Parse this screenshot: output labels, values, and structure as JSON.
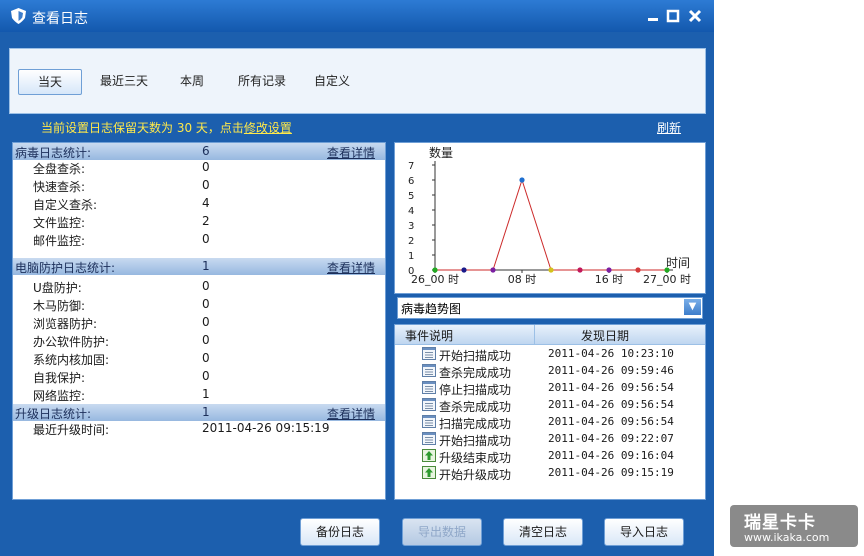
{
  "window": {
    "title": "查看日志"
  },
  "tabs": [
    {
      "label": "当天",
      "active": true
    },
    {
      "label": "最近三天",
      "active": false
    },
    {
      "label": "本周",
      "active": false
    },
    {
      "label": "所有记录",
      "active": false
    },
    {
      "label": "自定义",
      "active": false
    }
  ],
  "info": {
    "text": "当前设置日志保留天数为 30 天，点击",
    "link": "修改设置",
    "refresh": "刷新"
  },
  "stats": {
    "virus": {
      "label": "病毒日志统计:",
      "count": "6",
      "detail": "查看详情",
      "items": [
        {
          "label": "全盘查杀:",
          "count": "0"
        },
        {
          "label": "快速查杀:",
          "count": "0"
        },
        {
          "label": "自定义查杀:",
          "count": "4"
        },
        {
          "label": "文件监控:",
          "count": "2"
        },
        {
          "label": "邮件监控:",
          "count": "0"
        }
      ]
    },
    "protect": {
      "label": "电脑防护日志统计:",
      "count": "1",
      "detail": "查看详情",
      "items": [
        {
          "label": "U盘防护:",
          "count": "0"
        },
        {
          "label": "木马防御:",
          "count": "0"
        },
        {
          "label": "浏览器防护:",
          "count": "0"
        },
        {
          "label": "办公软件防护:",
          "count": "0"
        },
        {
          "label": "系统内核加固:",
          "count": "0"
        },
        {
          "label": "自我保护:",
          "count": "0"
        },
        {
          "label": "网络监控:",
          "count": "1"
        }
      ]
    },
    "upgrade": {
      "label": "升级日志统计:",
      "count": "1",
      "detail": "查看详情",
      "items": [
        {
          "label": "最近升级时间:",
          "count": "2011-04-26 09:15:19"
        }
      ]
    }
  },
  "chart_data": {
    "type": "line",
    "ylabel": "数量",
    "xlabel": "时间",
    "ylim": [
      0,
      7
    ],
    "yticks": [
      0,
      1,
      2,
      3,
      4,
      5,
      6,
      7
    ],
    "x_tick_labels": [
      "26_00 时",
      "08 时",
      "16 时",
      "27_00 时"
    ],
    "x": [
      0,
      3,
      6,
      9,
      12,
      15,
      18,
      21,
      24
    ],
    "values": [
      0,
      0,
      0,
      6,
      0,
      0,
      0,
      0,
      0
    ],
    "point_colors": [
      "#22aa22",
      "#1a1a8a",
      "#7b1fa2",
      "#1e6fd0",
      "#d4c21a",
      "#c2185b",
      "#7b1fa2",
      "#d43a3a",
      "#22aa22"
    ],
    "line_color": "#cc2a2a",
    "grid": false
  },
  "trend_select": {
    "value": "病毒趋势图"
  },
  "events": {
    "headers": [
      "事件说明",
      "发现日期"
    ],
    "rows": [
      {
        "name": "开始扫描成功",
        "date": "2011-04-26 10:23:10",
        "icon": "list-icon"
      },
      {
        "name": "查杀完成成功",
        "date": "2011-04-26 09:59:46",
        "icon": "list-icon"
      },
      {
        "name": "停止扫描成功",
        "date": "2011-04-26 09:56:54",
        "icon": "list-icon"
      },
      {
        "name": "查杀完成成功",
        "date": "2011-04-26 09:56:54",
        "icon": "list-icon"
      },
      {
        "name": "扫描完成成功",
        "date": "2011-04-26 09:56:54",
        "icon": "list-icon"
      },
      {
        "name": "开始扫描成功",
        "date": "2011-04-26 09:22:07",
        "icon": "list-icon"
      },
      {
        "name": "升级结束成功",
        "date": "2011-04-26 09:16:04",
        "icon": "upgrade-icon"
      },
      {
        "name": "开始升级成功",
        "date": "2011-04-26 09:15:19",
        "icon": "upgrade-icon"
      }
    ]
  },
  "buttons": {
    "backup": "备份日志",
    "export": "导出数据",
    "clear": "清空日志",
    "import": "导入日志"
  },
  "watermark": {
    "title": "瑞星卡卡",
    "url": "www.ikaka.com"
  }
}
